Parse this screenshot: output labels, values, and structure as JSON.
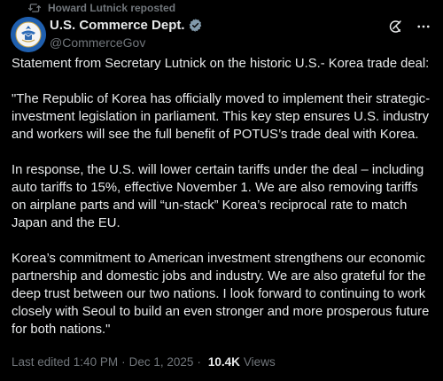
{
  "repost": {
    "text": "Howard Lutnick reposted",
    "icon": "repost-icon"
  },
  "author": {
    "display_name": "U.S. Commerce Dept.",
    "handle": "@CommerceGov",
    "verified_icon": "verified-badge-icon",
    "avatar_icon": "department-of-commerce-seal",
    "badge_color": "#829aab"
  },
  "actions": {
    "grok_icon": "grok-icon",
    "more_icon": "more-options-icon"
  },
  "post": {
    "paragraphs": [
      "Statement from Secretary Lutnick on the historic U.S.- Korea trade deal:",
      "\"The Republic of Korea has officially moved to implement their strategic-investment legislation in parliament. This key step ensures U.S. industry and workers will see the full benefit of POTUS’s trade deal with Korea.",
      "In response, the U.S. will lower certain tariffs under the deal – including auto tariffs to 15%, effective November 1. We are also removing tariffs on airplane parts and will “un-stack” Korea’s reciprocal rate to match Japan and the EU.",
      "Korea’s commitment to American investment strengthens our economic partnership and domestic jobs and industry.  We are also grateful for the deep trust between our two nations. I look forward to continuing to work closely with Seoul to build an even stronger and more prosperous future for both nations.\""
    ]
  },
  "meta": {
    "edited": "Last edited 1:40 PM",
    "separator": "·",
    "date": "Dec 1, 2025",
    "views_count": "10.4K",
    "views_label": "Views"
  },
  "colors": {
    "background": "#000000",
    "text": "#e7e9ea",
    "muted": "#71767b"
  }
}
